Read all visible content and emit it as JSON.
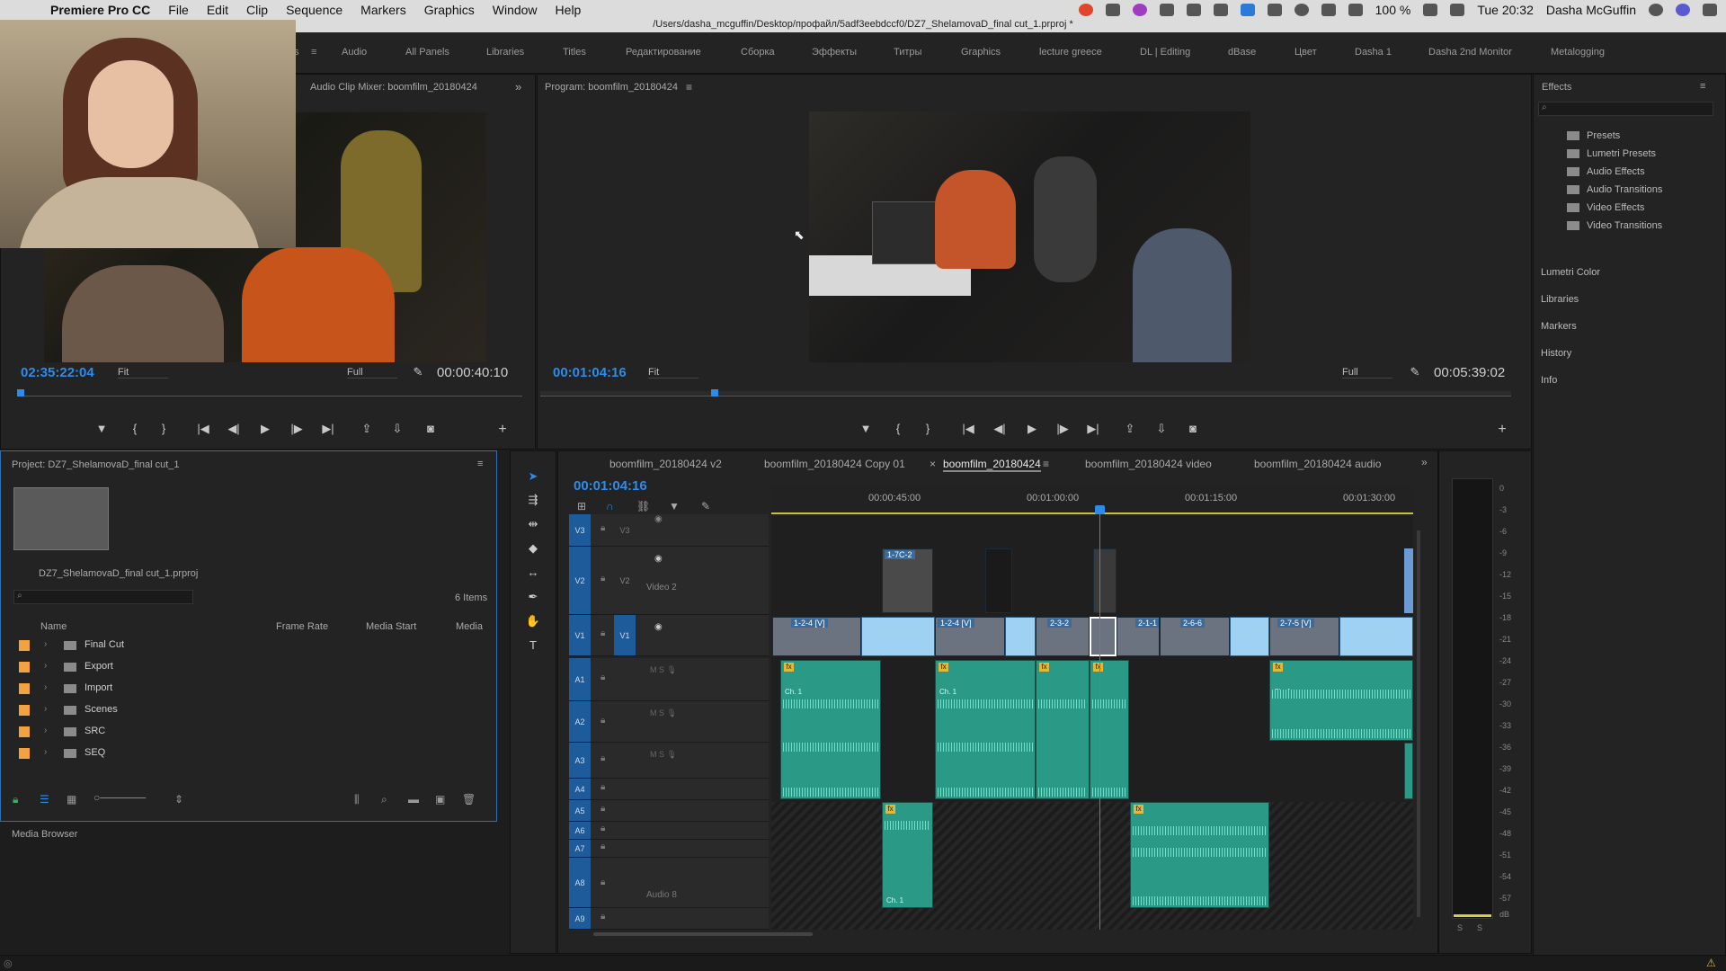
{
  "menubar": {
    "app_name": "Premiere Pro CC",
    "items": [
      "File",
      "Edit",
      "Clip",
      "Sequence",
      "Markers",
      "Graphics",
      "Window",
      "Help"
    ],
    "battery": "100 %",
    "clock": "Tue 20:32",
    "user": "Dasha McGuffin"
  },
  "window_title": "/Users/dasha_mcguffin/Desktop/профайл/5adf3eebdccf0/DZ7_ShelamovaD_final cut_1.prproj *",
  "workspaces": [
    "s",
    "Audio",
    "All Panels",
    "Libraries",
    "Titles",
    "Редактирование",
    "Сборка",
    "Эффекты",
    "Титры",
    "Graphics",
    "lecture greece",
    "DL | Editing",
    "dBase",
    "Цвет",
    "Dasha 1",
    "Dasha 2nd Monitor",
    "Metalogging"
  ],
  "source_monitor": {
    "title": "Audio Clip Mixer: boomfilm_20180424",
    "timecode_left": "02:35:22:04",
    "zoom": "Fit",
    "quality": "Full",
    "timecode_right": "00:00:40:10"
  },
  "program_monitor": {
    "title": "Program: boomfilm_20180424",
    "timecode_left": "00:01:04:16",
    "zoom": "Fit",
    "quality": "Full",
    "timecode_right": "00:05:39:02"
  },
  "transport": {
    "marker": "▼",
    "in": "{",
    "out": "}",
    "go_in": "|◀",
    "step_back": "◀|",
    "play": "▶",
    "step_fwd": "|▶",
    "go_out": "▶|",
    "lift": "⇪",
    "extract": "⇩",
    "camera": "◙",
    "add": "+"
  },
  "effects": {
    "title": "Effects",
    "tree": [
      "Presets",
      "Lumetri Presets",
      "Audio Effects",
      "Audio Transitions",
      "Video Effects",
      "Video Transitions"
    ],
    "sections": [
      "Lumetri Color",
      "Libraries",
      "Markers",
      "History",
      "Info"
    ]
  },
  "project": {
    "title": "Project: DZ7_ShelamovaD_final cut_1",
    "filename": "DZ7_ShelamovaD_final cut_1.prproj",
    "items_count": "6 Items",
    "columns": [
      "Name",
      "Frame Rate",
      "Media Start",
      "Media"
    ],
    "folders": [
      "Final Cut",
      "Export",
      "Import",
      "Scenes",
      "SRC",
      "SEQ"
    ],
    "media_browser": "Media Browser"
  },
  "timeline": {
    "tabs": [
      "boomfilm_20180424 v2",
      "boomfilm_20180424 Copy 01",
      "boomfilm_20180424",
      "boomfilm_20180424 video",
      "boomfilm_20180424 audio"
    ],
    "timecode": "00:01:04:16",
    "ruler": [
      "00:00:45:00",
      "00:01:00:00",
      "00:01:15:00",
      "00:01:30:00"
    ],
    "video_tracks": [
      "V3",
      "V2",
      "V1"
    ],
    "audio_tracks": [
      "A1",
      "A2",
      "A3",
      "A4",
      "A5",
      "A6",
      "A7",
      "A8",
      "A9"
    ],
    "v2_name": "Video 2",
    "a8_name": "Audio 8",
    "clip_labels": [
      "1-7C-2",
      "1-2-4 [V]",
      "1-2-4 [V]",
      "2-3-2",
      "2-1-1",
      "2-6-6",
      "2-7-5 [V]"
    ],
    "ch_label": "Ch. 1"
  },
  "meters": {
    "scale": [
      "0",
      "-3",
      "-6",
      "-9",
      "-12",
      "-15",
      "-18",
      "-21",
      "-24",
      "-27",
      "-30",
      "-33",
      "-36",
      "-39",
      "-42",
      "-45",
      "-48",
      "-51",
      "-54",
      "-57",
      "dB"
    ],
    "solo": "S"
  }
}
